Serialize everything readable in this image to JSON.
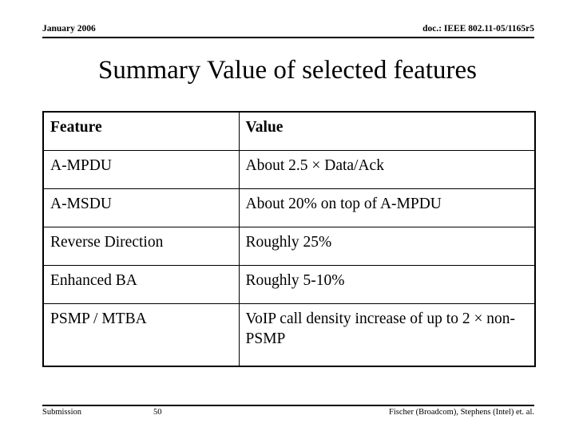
{
  "slide": {
    "header": {
      "left": "January 2006",
      "right": "doc.: IEEE 802.11-05/1165r5"
    },
    "title": "Summary Value of selected features",
    "table": {
      "columns": [
        "Feature",
        "Value"
      ],
      "rows": [
        {
          "feature": "A-MPDU",
          "value": "About 2.5 × Data/Ack"
        },
        {
          "feature": "A-MSDU",
          "value": "About 20% on top of A-MPDU"
        },
        {
          "feature": "Reverse Direction",
          "value": "Roughly 25%"
        },
        {
          "feature": "Enhanced BA",
          "value": "Roughly 5-10%"
        },
        {
          "feature": "PSMP / MTBA",
          "value": "VoIP call density increase of up to 2 × non-PSMP"
        }
      ]
    },
    "footer": {
      "left": "Submission",
      "page": "50",
      "right": "Fischer (Broadcom), Stephens (Intel) et. al."
    },
    "colors": {
      "background": "#ffffff",
      "text": "#000000",
      "rule": "#000000"
    }
  }
}
